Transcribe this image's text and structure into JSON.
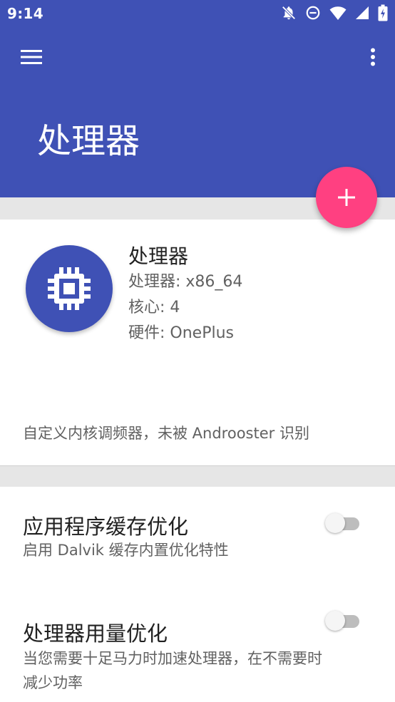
{
  "status_bar": {
    "time": "9:14",
    "icons": [
      "notifications-off-icon",
      "do-not-disturb-icon",
      "wifi-icon",
      "signal-icon",
      "battery-icon"
    ]
  },
  "app_bar": {
    "title": "处理器",
    "menu_icon": "menu-icon",
    "overflow_icon": "more-vert-icon",
    "color": "#3f51b5"
  },
  "fab": {
    "icon": "plus-icon",
    "color": "#ff4081"
  },
  "cpu_card": {
    "icon": "cpu-chip-icon",
    "title": "处理器",
    "lines": [
      "处理器: x86_64",
      "核心: 4",
      "硬件: OnePlus"
    ],
    "footer": "自定义内核调频器，未被 Androoster 识别"
  },
  "settings": [
    {
      "title": "应用程序缓存优化",
      "subtitle": "启用 Dalvik 缓存内置优化特性",
      "enabled": false
    },
    {
      "title": "处理器用量优化",
      "subtitle": "当您需要十足马力时加速处理器，在不需要时减少功率",
      "enabled": false
    }
  ]
}
